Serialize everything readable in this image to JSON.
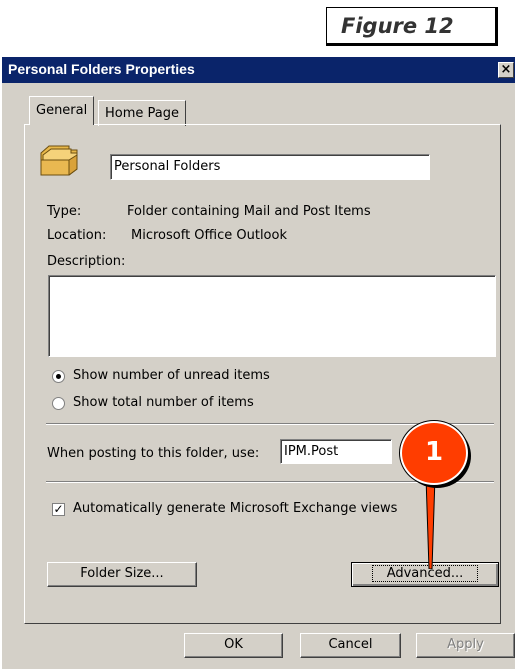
{
  "figure_caption": "Figure 12",
  "dialog": {
    "title": "Personal Folders Properties",
    "close_glyph": "×",
    "tabs": [
      {
        "label": "General",
        "active": true
      },
      {
        "label": "Home Page",
        "active": false
      }
    ],
    "name_value": "Personal Folders",
    "type_label": "Type:",
    "type_value": "Folder containing Mail and Post Items",
    "location_label": "Location:",
    "location_value": "Microsoft Office Outlook",
    "description_label": "Description:",
    "description_value": "",
    "radio_unread_label": "Show number of unread items",
    "radio_total_label": "Show total number of items",
    "selected_radio": "unread",
    "posting_label": "When posting to this folder, use:",
    "posting_value": "IPM.Post",
    "auto_views_label": "Automatically generate Microsoft Exchange views",
    "auto_views_checked": true,
    "folder_size_button": "Folder Size...",
    "advanced_button": "Advanced...",
    "ok_button": "OK",
    "cancel_button": "Cancel",
    "apply_button": "Apply"
  },
  "callout": {
    "number": "1",
    "color": "#ff3d00"
  },
  "colors": {
    "titlebar": "#0a246a",
    "dialog_face": "#d4d0c8"
  }
}
